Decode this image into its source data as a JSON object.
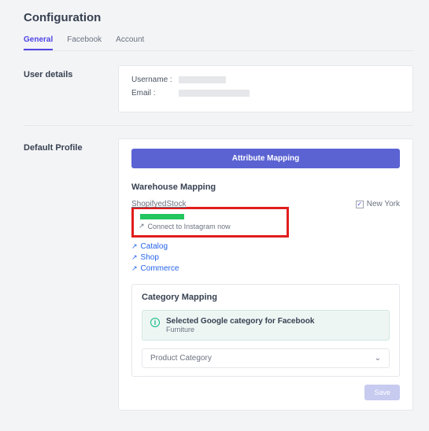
{
  "title": "Configuration",
  "tabs": {
    "general": "General",
    "facebook": "Facebook",
    "account": "Account"
  },
  "user": {
    "section_label": "User details",
    "username_label": "Username :",
    "email_label": "Email :"
  },
  "profile": {
    "section_label": "Default Profile",
    "attribute_btn": "Attribute Mapping",
    "warehouse": {
      "title": "Warehouse Mapping",
      "left_label": "ShopifyedStock",
      "checkbox_label": "New York",
      "connect_label": "Connect to Instagram now",
      "links": {
        "catalog": "Catalog",
        "shop": "Shop",
        "commerce": "Commerce"
      }
    },
    "category": {
      "title": "Category Mapping",
      "selected_title": "Selected Google category for Facebook",
      "selected_value": "Furniture",
      "dropdown_label": "Product Category"
    },
    "save_label": "Save"
  }
}
